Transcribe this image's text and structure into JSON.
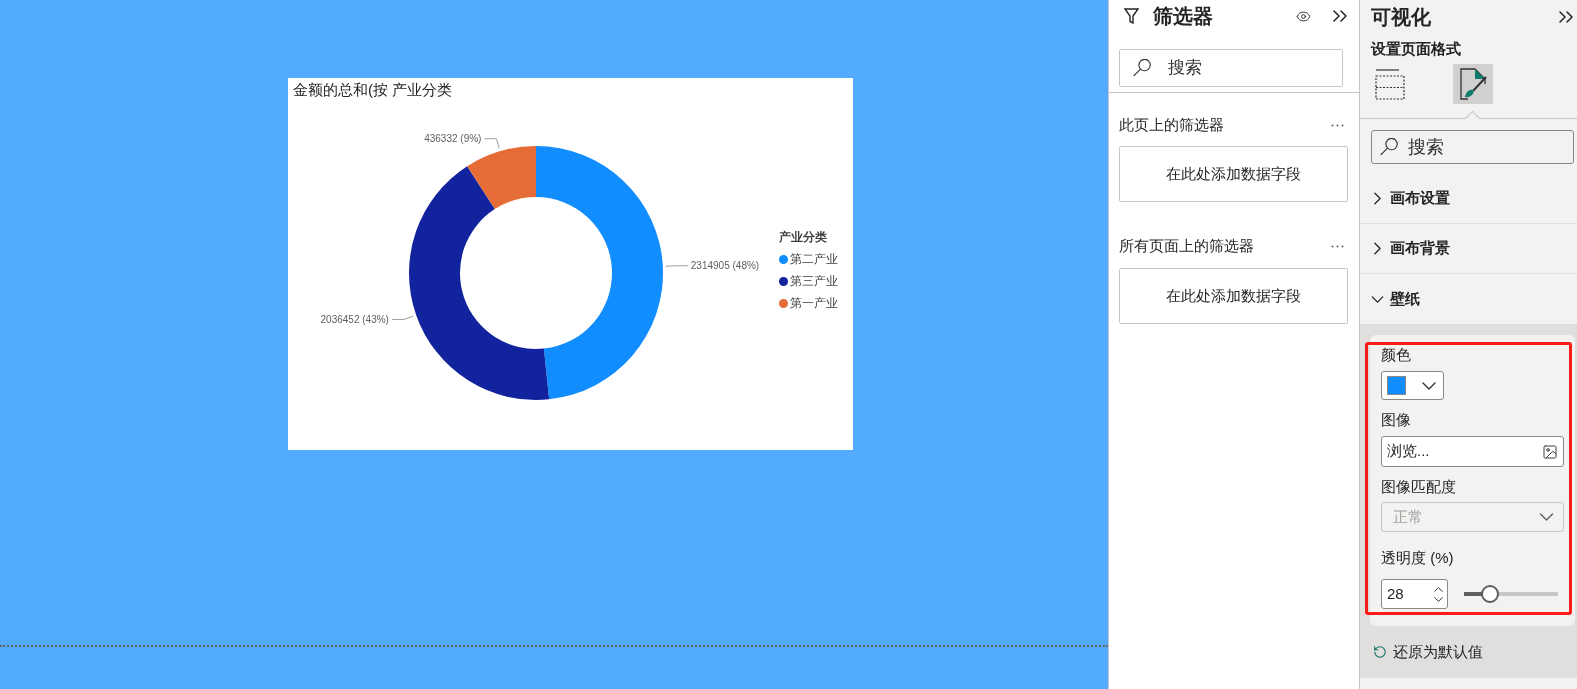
{
  "canvas": {
    "visual": {
      "chart_data": {
        "type": "donut",
        "title": "金额的总和(按 产业分类",
        "categories": [
          "第二产业",
          "第三产业",
          "第一产业"
        ],
        "values": [
          2314905,
          2036452,
          436332
        ],
        "value_labels": [
          "2314905 (48%)",
          "2036452 (43%)",
          "436332 (9%)"
        ],
        "colors": [
          "#118dff",
          "#12239e",
          "#e66c37"
        ],
        "legend": {
          "title": "产业分类"
        }
      }
    }
  },
  "filters_pane": {
    "title": "筛选器",
    "search": {
      "placeholder": "搜索"
    },
    "sections": [
      {
        "title": "此页上的筛选器",
        "drop_zone": "在此处添加数据字段"
      },
      {
        "title": "所有页面上的筛选器",
        "drop_zone": "在此处添加数据字段"
      }
    ]
  },
  "visualizations_pane": {
    "title": "可视化",
    "subtitle": "设置页面格式",
    "format_tabs": [
      {
        "kind": "fields",
        "selected": false
      },
      {
        "kind": "format",
        "selected": true
      }
    ],
    "search": {
      "placeholder": "搜索"
    },
    "sections": [
      {
        "title": "画布设置",
        "expanded": false
      },
      {
        "title": "画布背景",
        "expanded": false
      },
      {
        "title": "壁纸",
        "expanded": true
      }
    ],
    "wallpaper": {
      "color": {
        "label": "颜色",
        "color": "#118dff"
      },
      "image": {
        "label": "图像",
        "value": "浏览..."
      },
      "image_fit": {
        "label": "图像匹配度",
        "value": "正常",
        "disabled": true
      },
      "transparency": {
        "label": "透明度 (%)",
        "value": "28",
        "level": 0.28
      }
    },
    "reset": "还原为默认值"
  }
}
